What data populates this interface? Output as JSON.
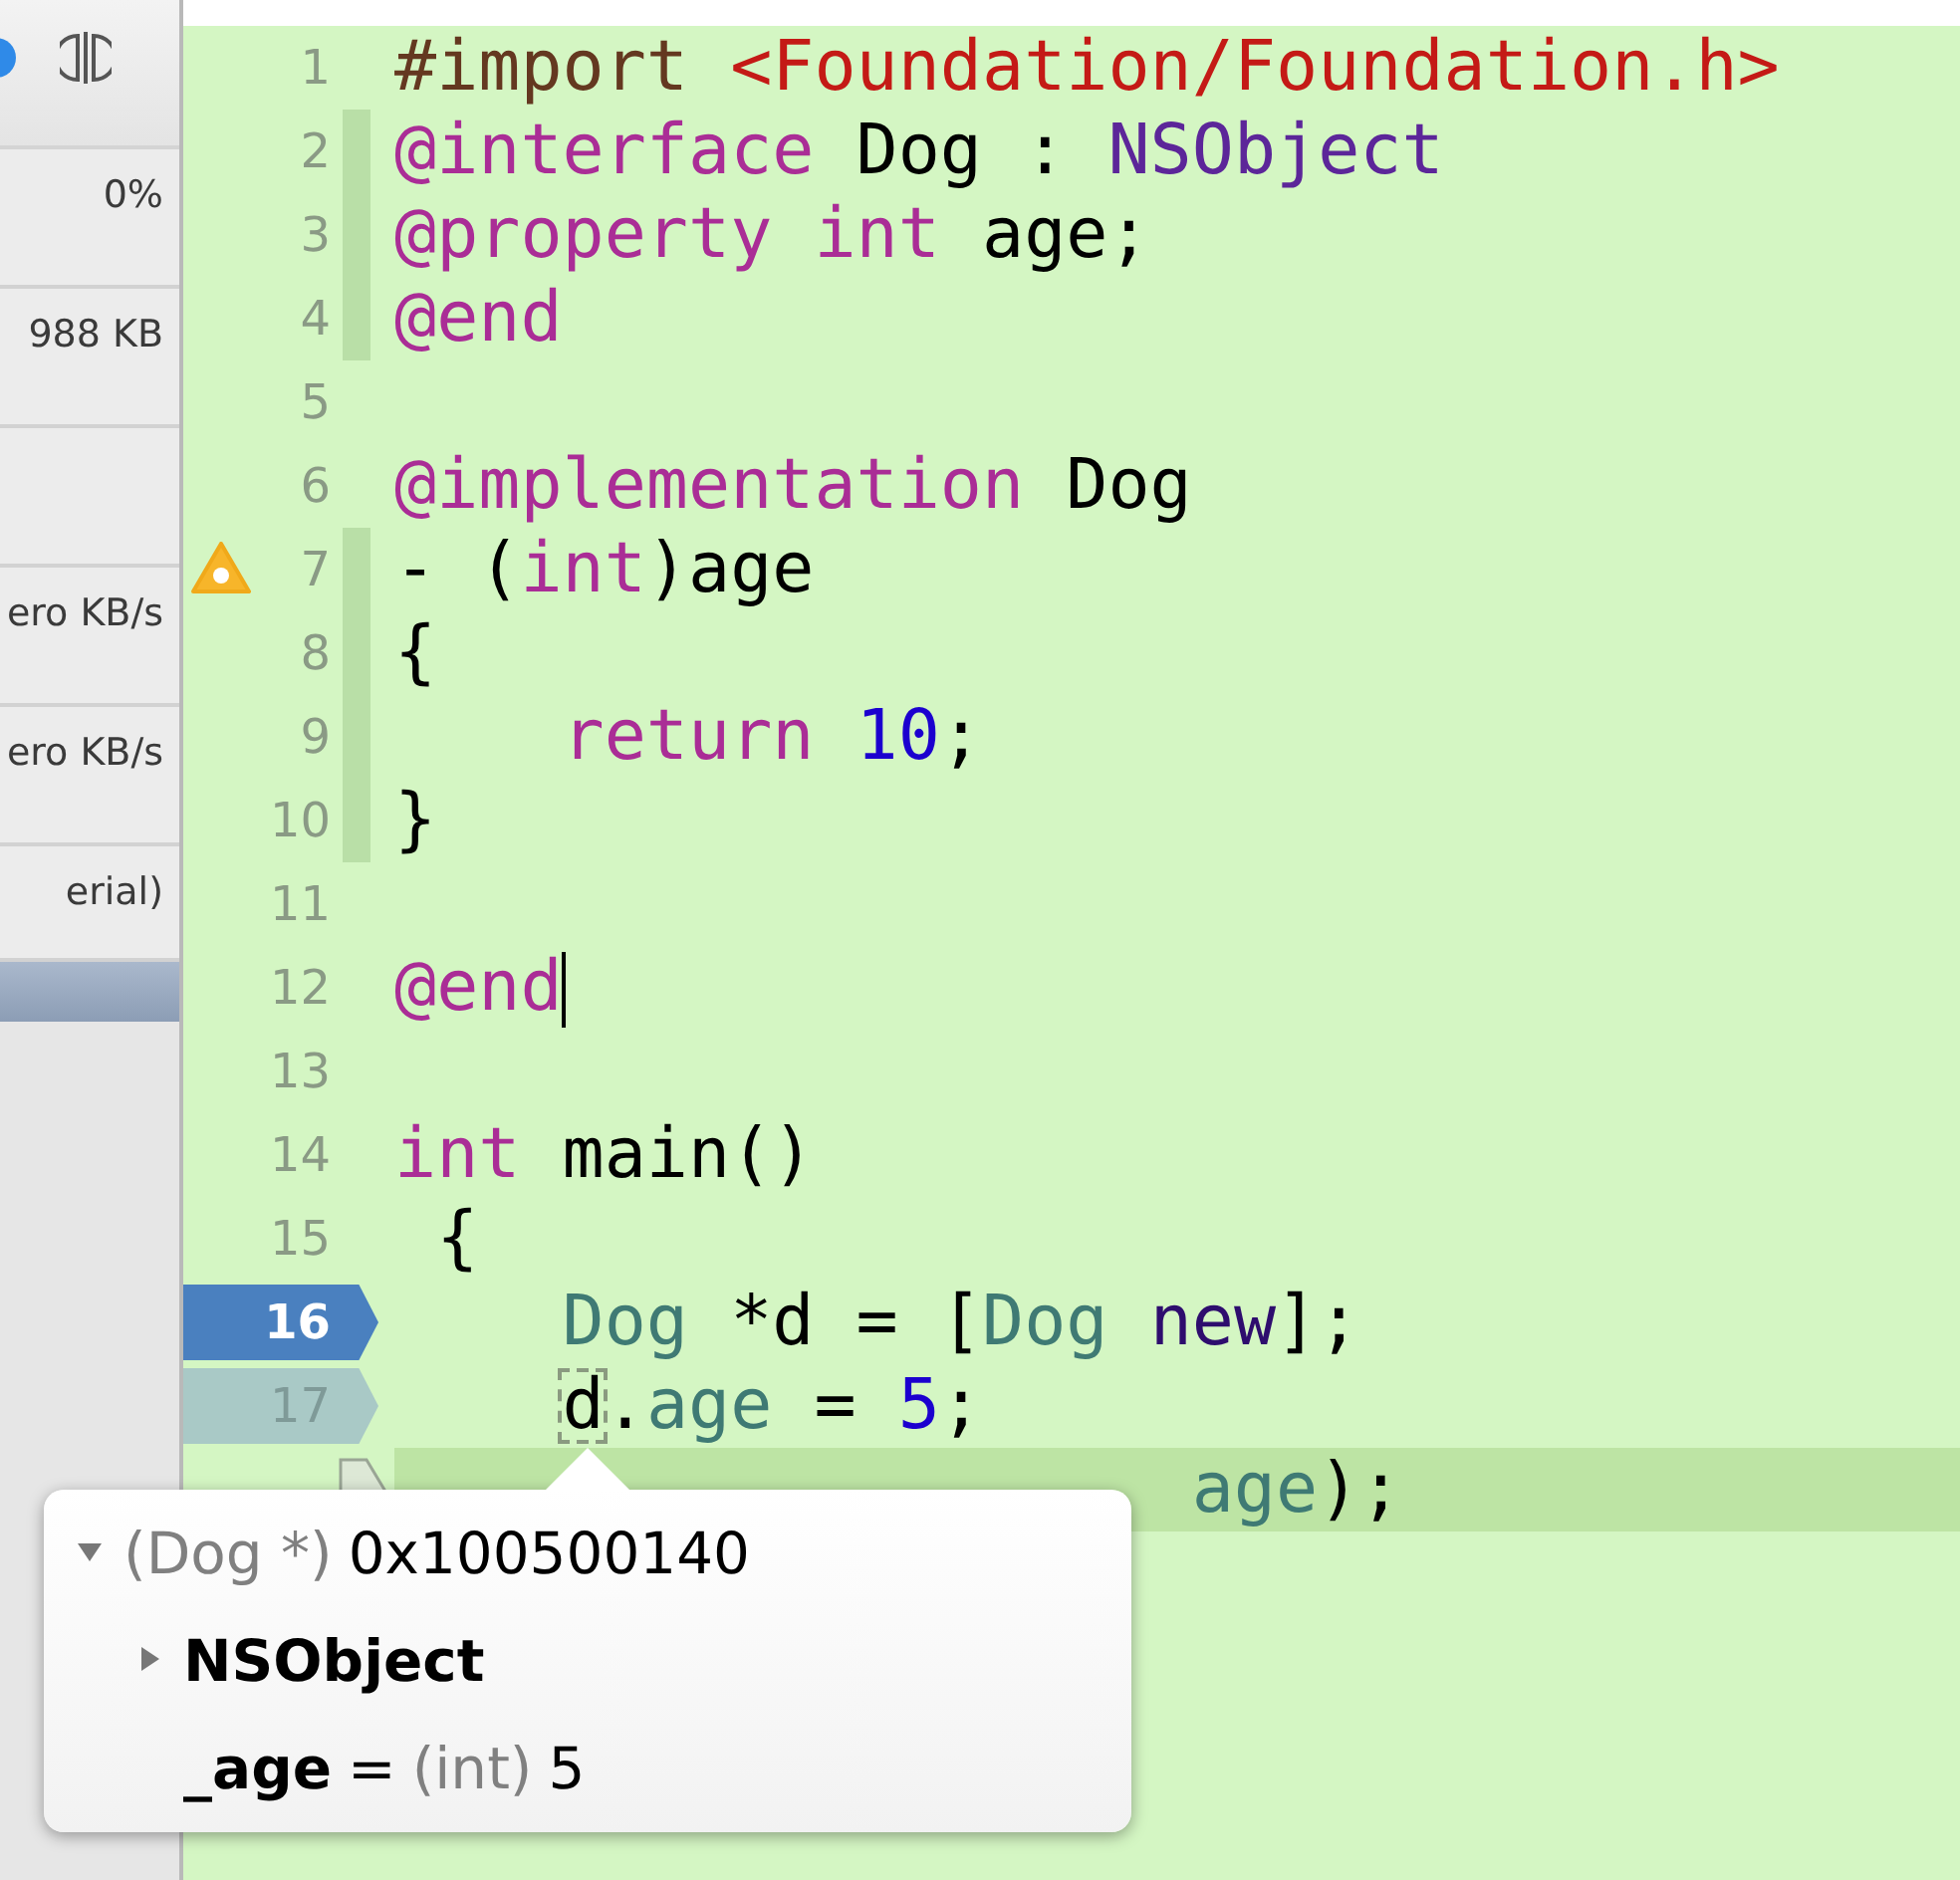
{
  "sidebar": {
    "rows": [
      {
        "value": "0%",
        "selected": false
      },
      {
        "value": "988 KB",
        "selected": false
      },
      {
        "selected": false
      },
      {
        "value": "ero KB/s",
        "selected": false
      },
      {
        "value": "ero KB/s",
        "selected": false
      },
      {
        "value": "erial)",
        "selected": false
      },
      {
        "selected": true
      }
    ]
  },
  "editor": {
    "lines": [
      {
        "number": "1",
        "tokens": [
          {
            "text": "#import ",
            "kind": "preprocessor"
          },
          {
            "text": "<Foundation/Foundation.h>",
            "kind": "string"
          }
        ]
      },
      {
        "number": "2",
        "scope": true,
        "tokens": [
          {
            "text": "@interface",
            "kind": "keyword"
          },
          {
            "text": " Dog : ",
            "kind": "plain"
          },
          {
            "text": "NSObject",
            "kind": "class"
          }
        ]
      },
      {
        "number": "3",
        "scope": true,
        "tokens": [
          {
            "text": "@property",
            "kind": "keyword"
          },
          {
            "text": " int",
            "kind": "keyword"
          },
          {
            "text": " age;",
            "kind": "plain"
          }
        ]
      },
      {
        "number": "4",
        "scope": true,
        "tokens": [
          {
            "text": "@end",
            "kind": "keyword"
          }
        ]
      },
      {
        "number": "5"
      },
      {
        "number": "6",
        "tokens": [
          {
            "text": "@implementation",
            "kind": "keyword"
          },
          {
            "text": " Dog",
            "kind": "plain"
          }
        ]
      },
      {
        "number": "7",
        "scope": true,
        "warning": true,
        "tokens": [
          {
            "text": "- (",
            "kind": "plain"
          },
          {
            "text": "int",
            "kind": "keyword"
          },
          {
            "text": ")age",
            "kind": "plain"
          }
        ]
      },
      {
        "number": "8",
        "scope": true,
        "tokens": [
          {
            "text": "{",
            "kind": "plain"
          }
        ]
      },
      {
        "number": "9",
        "scope": true,
        "tokens": [
          {
            "text": "    return",
            "kind": "keyword"
          },
          {
            "text": " 10",
            "kind": "number"
          },
          {
            "text": ";",
            "kind": "plain"
          }
        ]
      },
      {
        "number": "10",
        "scope": true,
        "tokens": [
          {
            "text": "}",
            "kind": "plain"
          }
        ]
      },
      {
        "number": "11"
      },
      {
        "number": "12",
        "caret": true,
        "tokens": [
          {
            "text": "@end",
            "kind": "keyword"
          }
        ]
      },
      {
        "number": "13"
      },
      {
        "number": "14",
        "tokens": [
          {
            "text": "int",
            "kind": "keyword"
          },
          {
            "text": " main()",
            "kind": "plain"
          }
        ]
      },
      {
        "number": "15",
        "tokens": [
          {
            "text": " {",
            "kind": "plain"
          }
        ]
      },
      {
        "number": "16",
        "breakpoint": true,
        "breakpoint_enabled": true,
        "tokens": [
          {
            "text": "    Dog",
            "kind": "project"
          },
          {
            "text": " *d = [",
            "kind": "plain"
          },
          {
            "text": "Dog",
            "kind": "project"
          },
          {
            "text": " new",
            "kind": "method"
          },
          {
            "text": "];",
            "kind": "plain"
          }
        ]
      },
      {
        "number": "17",
        "breakpoint": true,
        "breakpoint_enabled": false,
        "indented": true,
        "tokens": [
          {
            "text": "d",
            "kind": "plain",
            "highlight": true
          },
          {
            "text": ".",
            "kind": "plain"
          },
          {
            "text": "age",
            "kind": "project"
          },
          {
            "text": " = ",
            "kind": "plain"
          },
          {
            "text": "5",
            "kind": "number"
          },
          {
            "text": ";",
            "kind": "plain"
          }
        ]
      },
      {
        "current": true,
        "tokens": [
          {
            "text": "                   age",
            "kind": "project"
          },
          {
            "text": ");",
            "kind": "plain"
          }
        ]
      }
    ]
  },
  "popover": {
    "rows": [
      {
        "kind": "value",
        "expanded": true,
        "type": "(Dog *)",
        "value": "0x100500140"
      },
      {
        "kind": "group",
        "expanded": false,
        "name": "NSObject"
      },
      {
        "kind": "member",
        "name": "_age",
        "operator": "=",
        "type": "(int)",
        "value": "5"
      }
    ]
  }
}
